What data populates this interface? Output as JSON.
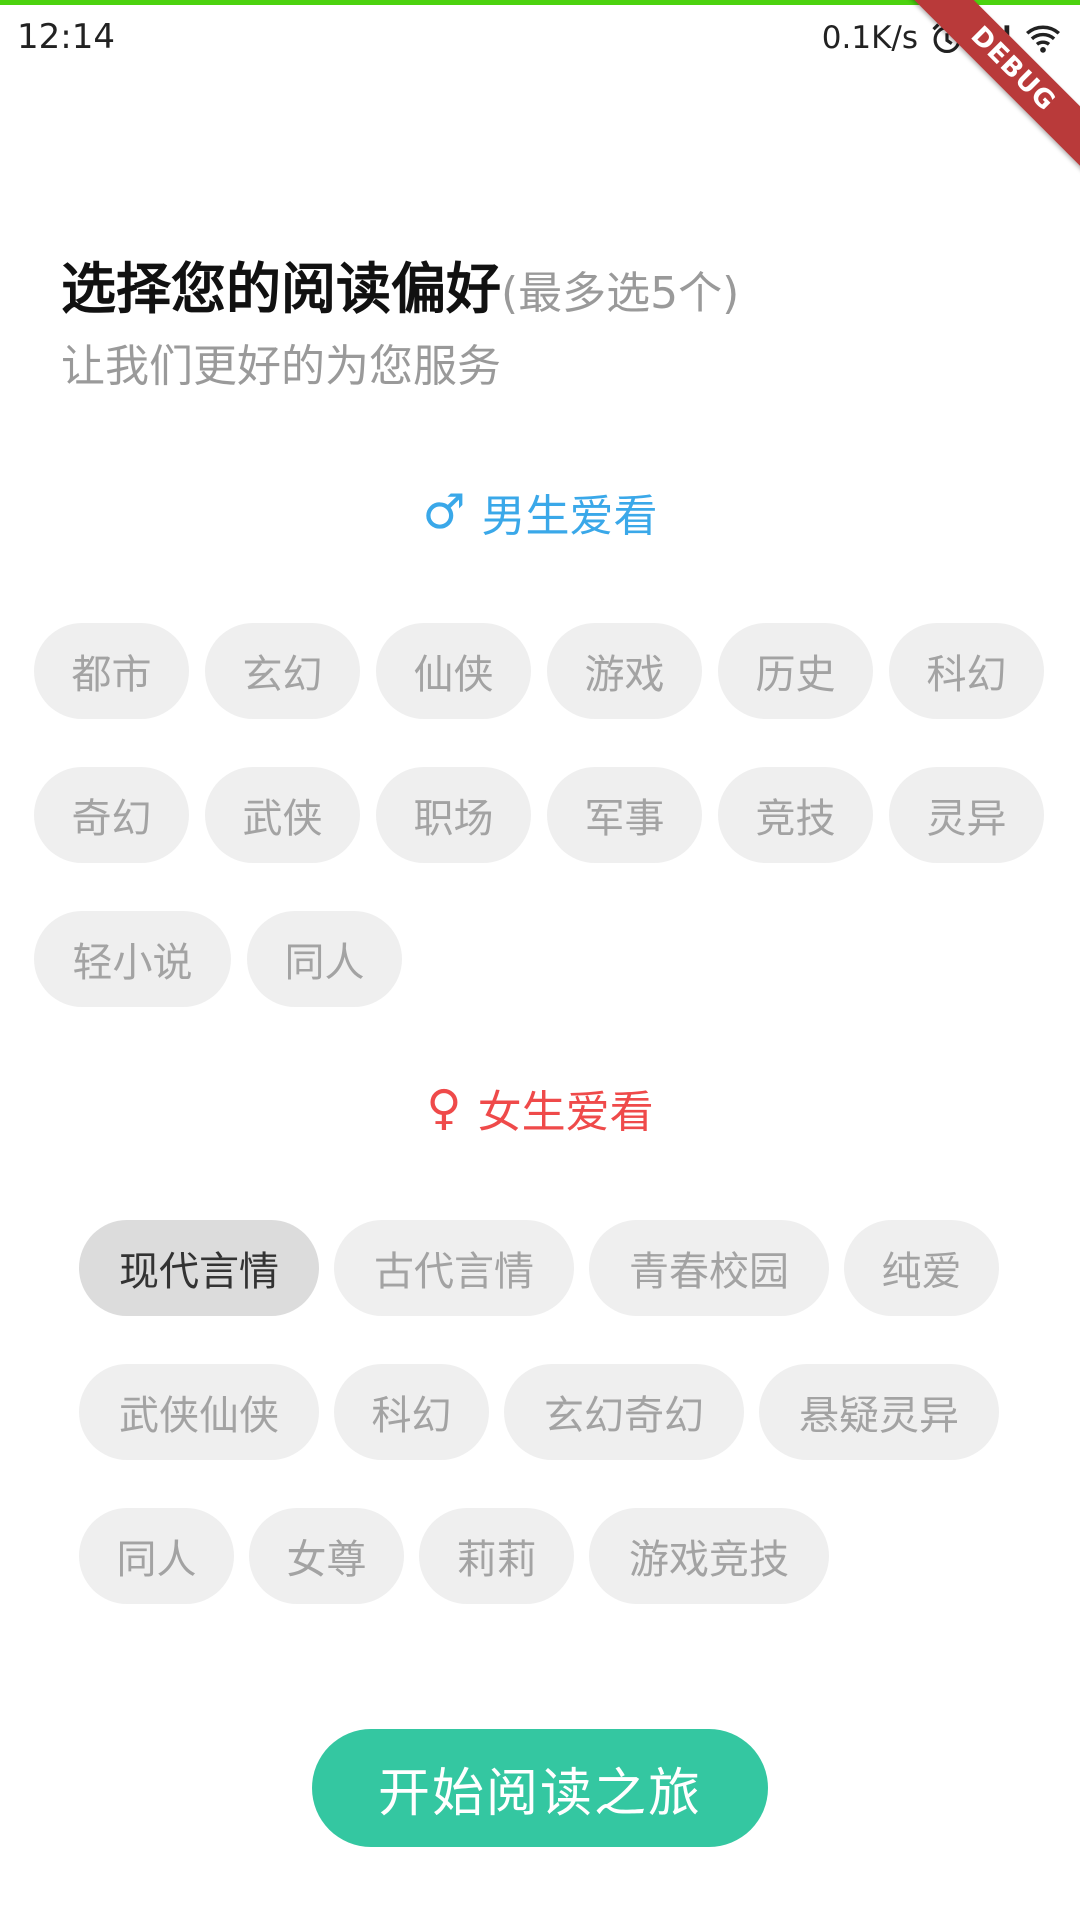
{
  "status_bar": {
    "time": "12:14",
    "net_speed": "0.1K/s",
    "icons": [
      "alarm-icon",
      "signal-icon",
      "wifi-icon"
    ]
  },
  "debug_banner": "DEBUG",
  "header": {
    "title": "选择您的阅读偏好",
    "title_note": "(最多选5个)",
    "subtitle": "让我们更好的为您服务"
  },
  "male_section": {
    "icon": "male-symbol-icon",
    "icon_glyph": "♂",
    "title": "男生爱看",
    "accent_color": "#3aa8e9",
    "tags": [
      "都市",
      "玄幻",
      "仙侠",
      "游戏",
      "历史",
      "科幻",
      "奇幻",
      "武侠",
      "职场",
      "军事",
      "竞技",
      "灵异",
      "轻小说",
      "同人"
    ]
  },
  "female_section": {
    "icon": "female-symbol-icon",
    "icon_glyph": "♀",
    "title": "女生爱看",
    "accent_color": "#ef4a4a",
    "tags": [
      "现代言情",
      "古代言情",
      "青春校园",
      "纯爱",
      "武侠仙侠",
      "科幻",
      "玄幻奇幻",
      "悬疑灵异",
      "同人",
      "女尊",
      "莉莉",
      "游戏竞技"
    ],
    "selected": [
      "现代言情"
    ]
  },
  "start_button": {
    "label": "开始阅读之旅",
    "color": "#34c7a1"
  }
}
